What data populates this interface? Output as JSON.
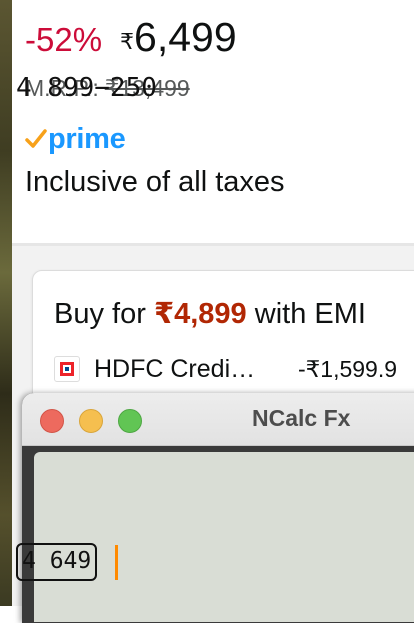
{
  "product": {
    "discount": "-52%",
    "price_symbol": "₹",
    "price_amount": "6,499",
    "mrp_label": "M.R.P.:",
    "mrp_value": "₹13,499",
    "prime_label": "prime",
    "tax_note": "Inclusive of all taxes"
  },
  "emi": {
    "title_prefix": "Buy for",
    "amount": "₹4,899",
    "title_suffix": "with EMI",
    "bank_name": "HDFC Credi…",
    "bank_discount": "-₹1,599.9"
  },
  "ncalc": {
    "window_title": "NCalc Fx",
    "expression": "4 899−250",
    "result": "4 649"
  },
  "colors": {
    "discount_red": "#cc0c39",
    "emi_red": "#b12704",
    "prime_blue": "#1a98ff",
    "prime_check_orange": "#f7a11a",
    "display_bg": "#d9ddd5",
    "cursor_orange": "#ff8a00"
  }
}
